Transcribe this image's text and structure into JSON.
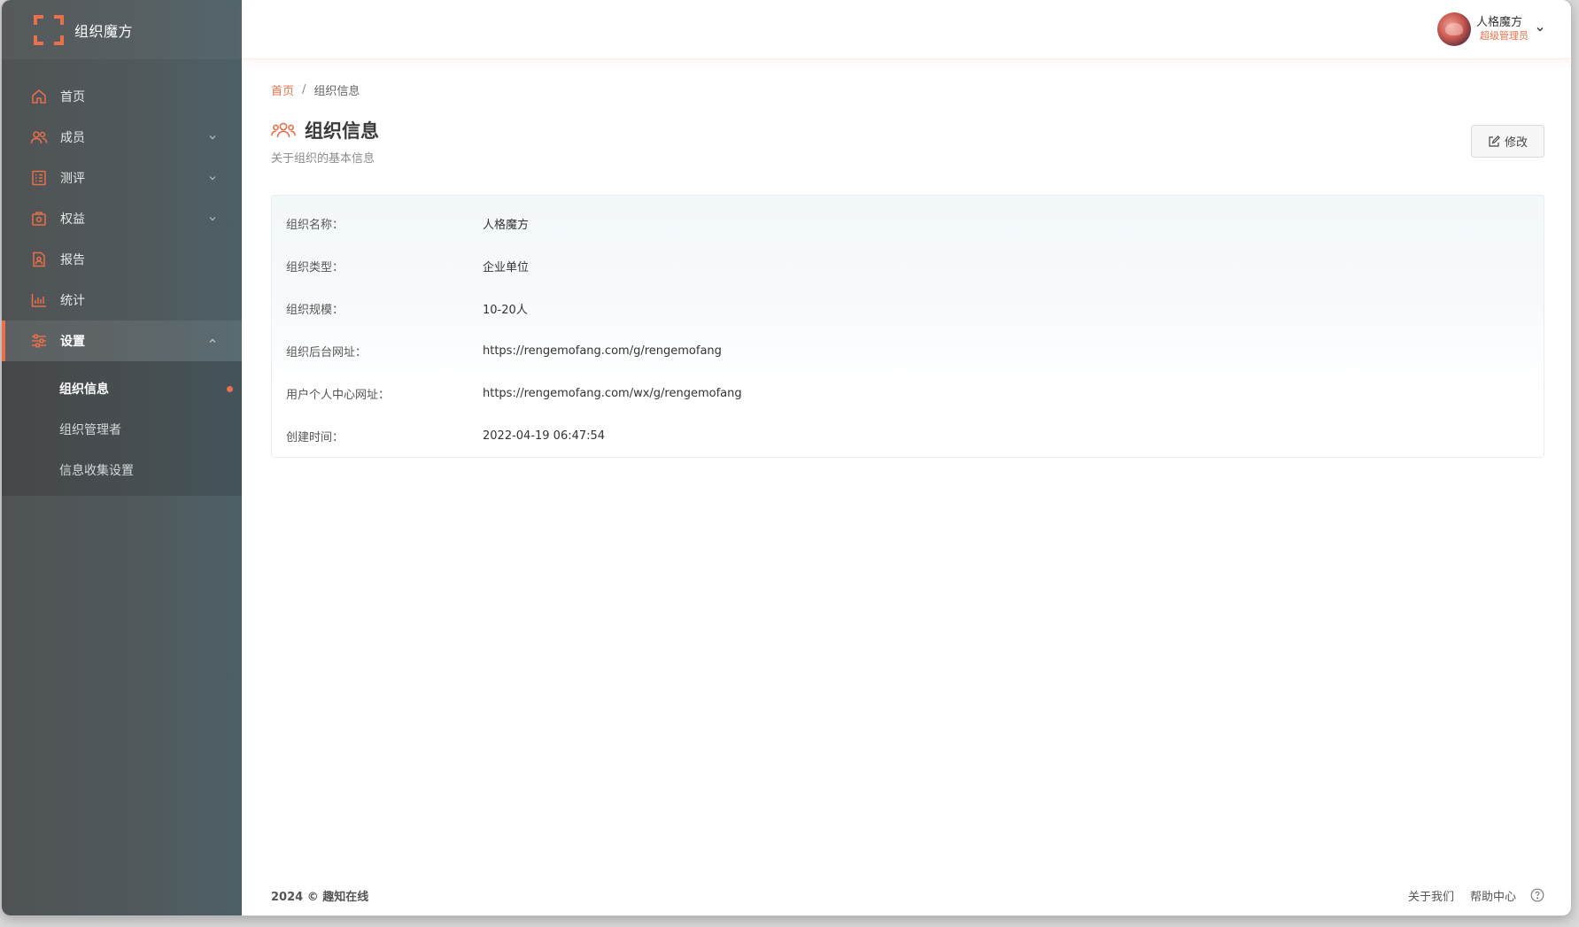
{
  "brand": {
    "title": "组织魔方",
    "logo_icon": "bracket-logo-icon",
    "accent": "#e8704a"
  },
  "sidebar": {
    "items": [
      {
        "label": "首页",
        "icon": "home-icon"
      },
      {
        "label": "成员",
        "icon": "members-icon"
      },
      {
        "label": "测评",
        "icon": "assessment-icon"
      },
      {
        "label": "权益",
        "icon": "benefits-icon"
      },
      {
        "label": "报告",
        "icon": "report-icon"
      },
      {
        "label": "统计",
        "icon": "statistics-icon"
      },
      {
        "label": "设置",
        "icon": "settings-icon"
      }
    ],
    "settings_submenu": [
      {
        "label": "组织信息"
      },
      {
        "label": "组织管理者"
      },
      {
        "label": "信息收集设置"
      }
    ]
  },
  "header": {
    "user_name": "人格魔方",
    "user_role": "超级管理员"
  },
  "breadcrumb": {
    "home": "首页",
    "separator": "/",
    "current": "组织信息"
  },
  "page": {
    "title": "组织信息",
    "subtitle": "关于组织的基本信息",
    "edit_label": "修改"
  },
  "info": [
    {
      "label": "组织名称：",
      "value": "人格魔方"
    },
    {
      "label": "组织类型：",
      "value": "企业单位"
    },
    {
      "label": "组织规模：",
      "value": "10-20人"
    },
    {
      "label": "组织后台网址：",
      "value": "https://rengemofang.com/g/rengemofang"
    },
    {
      "label": "用户个人中心网址：",
      "value": "https://rengemofang.com/wx/g/rengemofang"
    },
    {
      "label": "创建时间：",
      "value": "2022-04-19 06:47:54"
    }
  ],
  "footer": {
    "copyright": "2024 © 趣知在线",
    "about": "关于我们",
    "help": "帮助中心"
  }
}
